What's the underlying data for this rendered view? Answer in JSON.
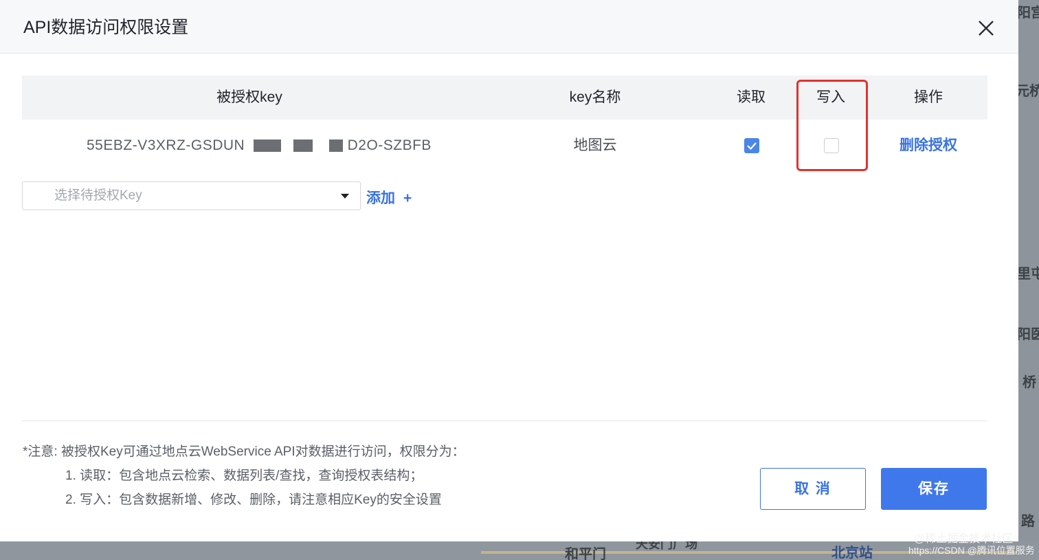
{
  "dialog": {
    "title": "API数据访问权限设置"
  },
  "table": {
    "headers": {
      "key": "被授权key",
      "key_name": "key名称",
      "read": "读取",
      "write": "写入",
      "action": "操作"
    },
    "rows": [
      {
        "key_prefix": "55EBZ-V3XRZ-GSDUN",
        "key_suffix": "D2O-SZBFB",
        "key_name": "地图云",
        "read": true,
        "write": false,
        "action": "删除授权"
      }
    ]
  },
  "add_row": {
    "placeholder": "选择待授权Key",
    "add_label": "添加",
    "add_icon": "+"
  },
  "notes": {
    "line1": "*注意: 被授权Key可通过地点云WebService API对数据进行访问，权限分为：",
    "line2": "1. 读取：包含地点云检索、数据列表/查找，查询授权表结构；",
    "line3": "2. 写入：包含数据新增、修改、删除，请注意相应Key的安全设置"
  },
  "buttons": {
    "cancel": "取 消",
    "save": "保存"
  },
  "background_map": {
    "labels": [
      "阳宫",
      "元桥",
      "里屯",
      "阳医",
      "桥",
      "路",
      "和平门",
      "北京站",
      "天安门广场"
    ]
  },
  "watermark": {
    "line1": "@稀土掘金技术社区",
    "line2": "https://CSDN @腾讯位置服务"
  },
  "colors": {
    "accent": "#3f78ea",
    "link": "#3a73e0",
    "highlight_border": "#e0322e",
    "header_bg": "#f7f8fa",
    "table_head_bg": "#f2f3f5"
  }
}
